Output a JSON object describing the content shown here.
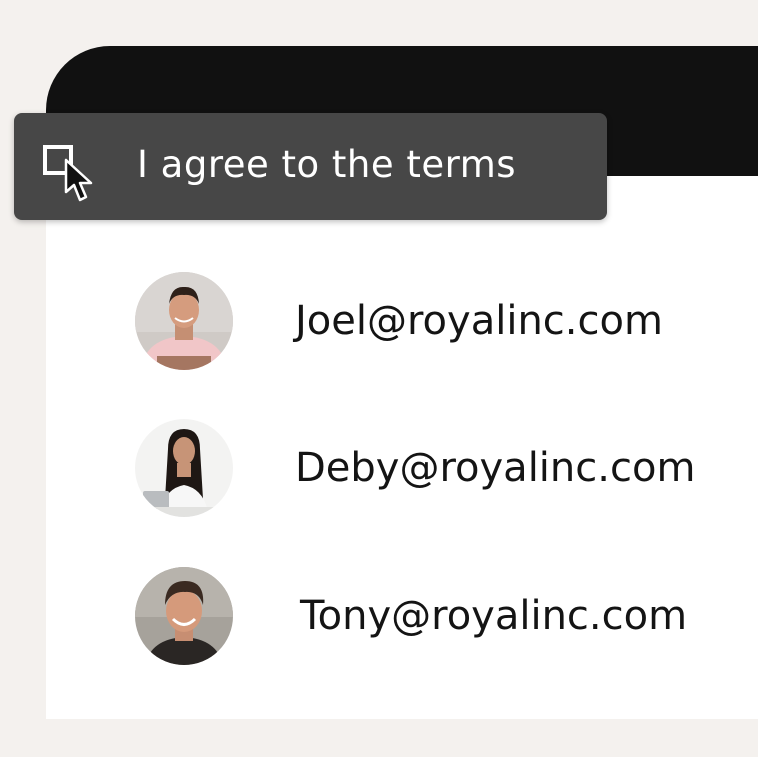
{
  "consent": {
    "label": "I agree to the terms",
    "checked": false
  },
  "users": [
    {
      "email": "Joel@royalinc.com",
      "avatar_icon": "person-avatar-icon"
    },
    {
      "email": "Deby@royalinc.com",
      "avatar_icon": "person-avatar-icon"
    },
    {
      "email": "Tony@royalinc.com",
      "avatar_icon": "person-avatar-icon"
    }
  ],
  "colors": {
    "page_background": "#f4f1ee",
    "window_header": "#111111",
    "window_body": "#ffffff",
    "consent_bar": "#474747",
    "text_light": "#ffffff",
    "text_dark": "#141414"
  }
}
